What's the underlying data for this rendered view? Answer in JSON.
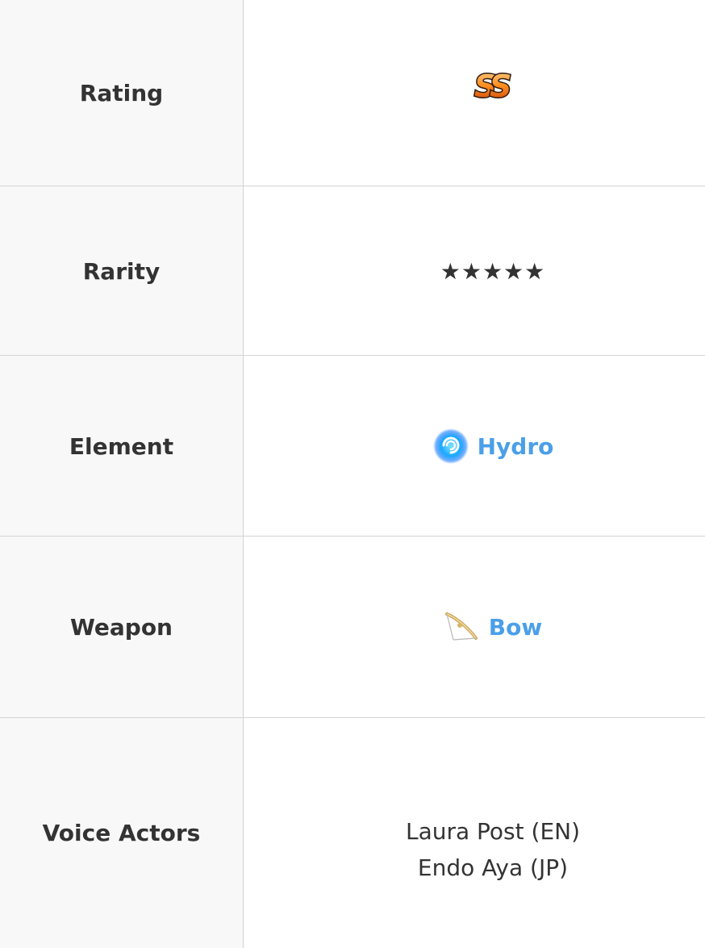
{
  "rows": {
    "rating": {
      "label": "Rating",
      "icon": "ss-rank-badge-icon"
    },
    "rarity": {
      "label": "Rarity",
      "value": "★★★★★"
    },
    "element": {
      "label": "Element",
      "value": "Hydro",
      "icon": "hydro-element-icon",
      "color": "#4a9fe8"
    },
    "weapon": {
      "label": "Weapon",
      "value": "Bow",
      "icon": "bow-weapon-icon",
      "color": "#4a9fe8"
    },
    "voice_actors": {
      "label": "Voice Actors",
      "values": [
        "Laura Post (EN)",
        "Endo Aya (JP)"
      ]
    }
  },
  "colors": {
    "label_bg": "#f8f8f8",
    "border": "#d4d4d4",
    "text": "#333333",
    "link": "#4a9fe8"
  }
}
